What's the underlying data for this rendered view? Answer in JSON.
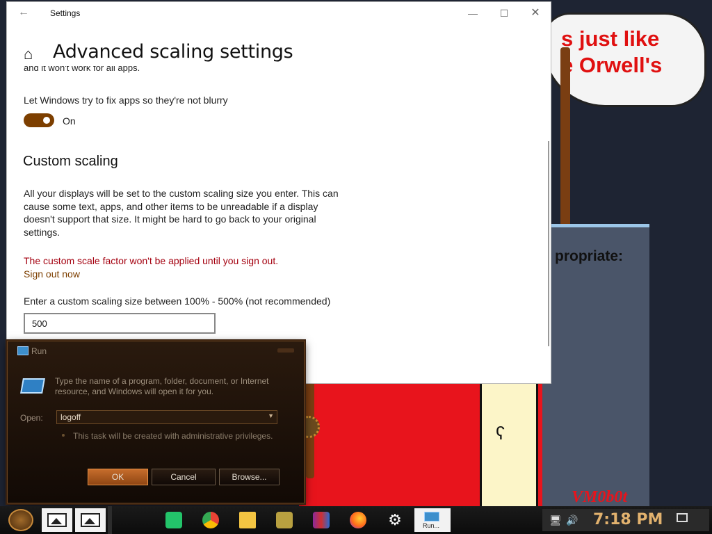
{
  "desktop": {
    "bubble_line1": "s just like",
    "bubble_line2": "e Orwell's",
    "panel_text": "propriate:",
    "signature": "VM0b0t"
  },
  "settings": {
    "window_title": "Settings",
    "page_title": "Advanced scaling settings",
    "cut_line": "and it won't work for all apps.",
    "fix_blurry_label": "Let Windows try to fix apps so they're not blurry",
    "fix_blurry_state": "On",
    "section_title": "Custom scaling",
    "description": "All your displays will be set to the custom scaling size you enter. This can cause some text, apps, and other items to be unreadable if a display doesn't support that size. It might be hard to go back to your original settings.",
    "warning": "The custom scale factor won't be applied until you sign out.",
    "signout_link": "Sign out now",
    "entry_label": "Enter a custom scaling size between 100% - 500% (not recommended)",
    "scale_value": "500"
  },
  "run": {
    "title": "Run",
    "description": "Type the name of a program, folder, document, or Internet resource, and Windows will open it for you.",
    "open_label": "Open:",
    "open_value": "logoff",
    "admin_note": "This task will be created with administrative privileges.",
    "ok_label": "OK",
    "cancel_label": "Cancel",
    "browse_label": "Browse..."
  },
  "taskbar": {
    "run_task_label": "Run...",
    "clock": "7:18 PM"
  },
  "colors": {
    "accent": "#7d3f00",
    "warning": "#a4000f",
    "clock": "#e2b26e"
  }
}
